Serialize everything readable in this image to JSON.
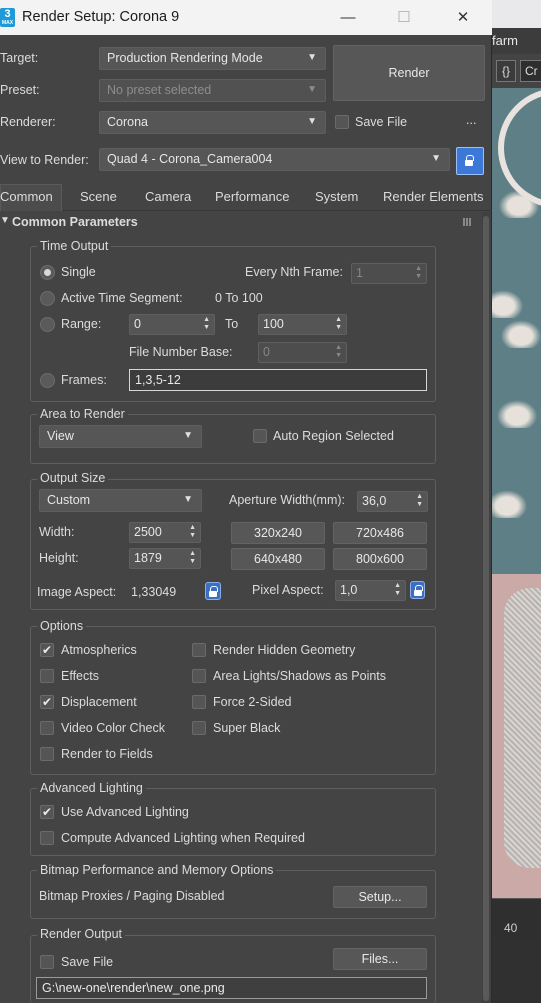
{
  "window": {
    "title": "Render Setup: Corona 9",
    "app_icon_text": "3",
    "app_icon_sub": "MAX",
    "min_glyph": "—",
    "max_glyph": "☐",
    "close_glyph": "✕"
  },
  "background": {
    "top_label": "farm",
    "toolbar_btn1": "{}",
    "toolbar_btn2": "Cr",
    "ruler_label": "40"
  },
  "header": {
    "target_label": "Target:",
    "target_value": "Production Rendering Mode",
    "preset_label": "Preset:",
    "preset_value": "No preset selected",
    "renderer_label": "Renderer:",
    "renderer_value": "Corona",
    "save_file_label": "Save File",
    "save_file_checked": false,
    "more_label": "...",
    "render_button": "Render",
    "view_label": "View to Render:",
    "view_value": "Quad 4 - Corona_Camera004",
    "dropdown_arrow": "▼"
  },
  "tabs": [
    {
      "label": "Common",
      "active": true
    },
    {
      "label": "Scene"
    },
    {
      "label": "Camera"
    },
    {
      "label": "Performance"
    },
    {
      "label": "System"
    },
    {
      "label": "Render Elements"
    }
  ],
  "rollout": {
    "title": "Common Parameters",
    "collapse_glyph": "▼"
  },
  "time_output": {
    "title": "Time Output",
    "single": "Single",
    "every_nth_label": "Every Nth Frame:",
    "every_nth_value": "1",
    "active_segment": "Active Time Segment:",
    "active_segment_value": "0 To 100",
    "range": "Range:",
    "range_from": "0",
    "range_to_label": "To",
    "range_to": "100",
    "file_number_base_label": "File Number Base:",
    "file_number_base_value": "0",
    "frames": "Frames:",
    "frames_value": "1,3,5-12",
    "selected": "single"
  },
  "area_to_render": {
    "title": "Area to Render",
    "value": "View",
    "auto_region": "Auto Region Selected",
    "auto_region_checked": false
  },
  "output_size": {
    "title": "Output Size",
    "preset": "Custom",
    "aperture_label": "Aperture Width(mm):",
    "aperture_value": "36,0",
    "width_label": "Width:",
    "width_value": "2500",
    "height_label": "Height:",
    "height_value": "1879",
    "presets": [
      "320x240",
      "720x486",
      "640x480",
      "800x600"
    ],
    "image_aspect_label": "Image Aspect:",
    "image_aspect_value": "1,33049",
    "pixel_aspect_label": "Pixel Aspect:",
    "pixel_aspect_value": "1,0"
  },
  "options": {
    "title": "Options",
    "left": [
      {
        "label": "Atmospherics",
        "checked": true
      },
      {
        "label": "Effects",
        "checked": false
      },
      {
        "label": "Displacement",
        "checked": true
      },
      {
        "label": "Video Color Check",
        "checked": false
      },
      {
        "label": "Render to Fields",
        "checked": false
      }
    ],
    "right": [
      {
        "label": "Render Hidden Geometry",
        "checked": false
      },
      {
        "label": "Area Lights/Shadows as Points",
        "checked": false
      },
      {
        "label": "Force 2-Sided",
        "checked": false
      },
      {
        "label": "Super Black",
        "checked": false
      }
    ]
  },
  "advanced_lighting": {
    "title": "Advanced Lighting",
    "use": "Use Advanced Lighting",
    "use_checked": true,
    "compute": "Compute Advanced Lighting when Required",
    "compute_checked": false
  },
  "bitmap": {
    "title": "Bitmap Performance and Memory Options",
    "status": "Bitmap Proxies / Paging Disabled",
    "setup_button": "Setup..."
  },
  "render_output": {
    "title": "Render Output",
    "save_file": "Save File",
    "save_file_checked": false,
    "files_button": "Files...",
    "path": "G:\\new-one\\render\\new_one.png"
  },
  "glyphs": {
    "check": "✔",
    "spin_up": "▲",
    "spin_down": "▼"
  }
}
